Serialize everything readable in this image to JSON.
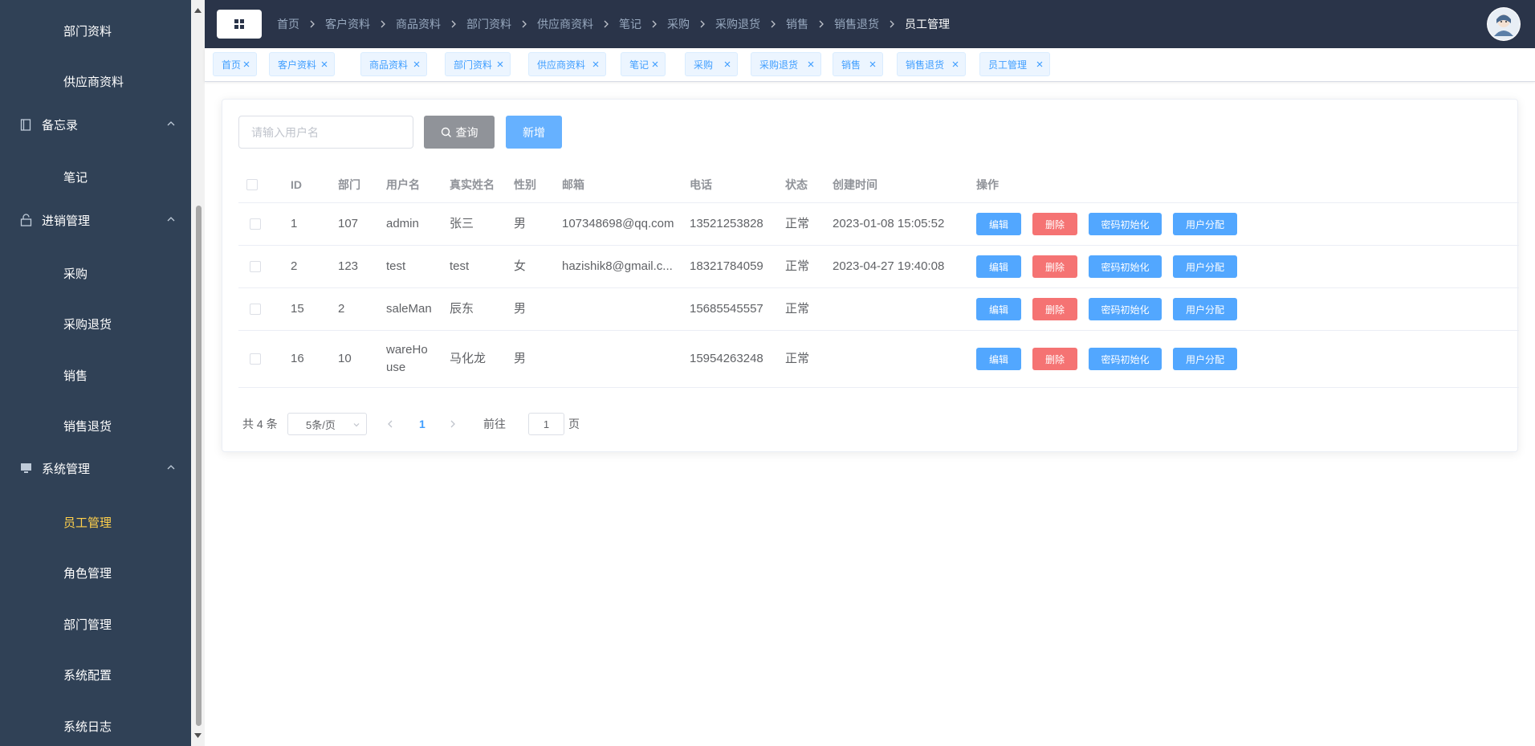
{
  "sidebar": {
    "items": [
      {
        "label": "部门资料",
        "type": "sub",
        "active": false
      },
      {
        "label": "供应商资料",
        "type": "sub",
        "active": false
      },
      {
        "label": "备忘录",
        "type": "group",
        "icon": "notebook-icon"
      },
      {
        "label": "笔记",
        "type": "sub",
        "active": false
      },
      {
        "label": "进销管理",
        "type": "group",
        "icon": "lock-icon"
      },
      {
        "label": "采购",
        "type": "sub",
        "active": false
      },
      {
        "label": "采购退货",
        "type": "sub",
        "active": false
      },
      {
        "label": "销售",
        "type": "sub",
        "active": false
      },
      {
        "label": "销售退货",
        "type": "sub",
        "active": false
      },
      {
        "label": "系统管理",
        "type": "group",
        "icon": "monitor-icon"
      },
      {
        "label": "员工管理",
        "type": "sub",
        "active": true
      },
      {
        "label": "角色管理",
        "type": "sub",
        "active": false
      },
      {
        "label": "部门管理",
        "type": "sub",
        "active": false
      },
      {
        "label": "系统配置",
        "type": "sub",
        "active": false
      },
      {
        "label": "系统日志",
        "type": "sub",
        "active": false
      }
    ]
  },
  "header": {
    "breadcrumb": [
      "首页",
      "客户资料",
      "商品资料",
      "部门资料",
      "供应商资料",
      "笔记",
      "采购",
      "采购退货",
      "销售",
      "销售退货",
      "员工管理"
    ]
  },
  "tags": [
    "首页",
    "客户资料",
    "商品资料",
    "部门资料",
    "供应商资料",
    "笔记",
    "采购",
    "采购退货",
    "销售",
    "销售退货",
    "员工管理"
  ],
  "search": {
    "placeholder": "请输入用户名",
    "query_label": "查询",
    "add_label": "新增"
  },
  "table": {
    "columns": [
      "ID",
      "部门",
      "用户名",
      "真实姓名",
      "性别",
      "邮箱",
      "电话",
      "状态",
      "创建时间",
      "操作"
    ],
    "rows": [
      {
        "id": "1",
        "dept": "107",
        "username": "admin",
        "realname": "张三",
        "gender": "男",
        "email": "107348698@qq.com",
        "phone": "13521253828",
        "status": "正常",
        "created": "2023-01-08 15:05:52"
      },
      {
        "id": "2",
        "dept": "123",
        "username": "test",
        "realname": "test",
        "gender": "女",
        "email": "hazishik8@gmail.c...",
        "phone": "18321784059",
        "status": "正常",
        "created": "2023-04-27 19:40:08"
      },
      {
        "id": "15",
        "dept": "2",
        "username": "saleMan",
        "realname": "辰东",
        "gender": "男",
        "email": "",
        "phone": "15685545557",
        "status": "正常",
        "created": ""
      },
      {
        "id": "16",
        "dept": "10",
        "username": "wareHouse",
        "realname": "马化龙",
        "gender": "男",
        "email": "",
        "phone": "15954263248",
        "status": "正常",
        "created": ""
      }
    ],
    "actions": {
      "edit": "编辑",
      "delete": "删除",
      "reset_password": "密码初始化",
      "assign": "用户分配"
    }
  },
  "pagination": {
    "total": "共 4 条",
    "page_size": "5条/页",
    "current_page": "1",
    "goto_label": "前往",
    "goto_value": "1",
    "page_unit": "页"
  },
  "colors": {
    "sidebar_bg": "#304156",
    "header_bg": "#2a3449",
    "active_menu": "#ffd04b",
    "primary": "#409eff",
    "danger": "#f56c6c",
    "info": "#909399"
  }
}
